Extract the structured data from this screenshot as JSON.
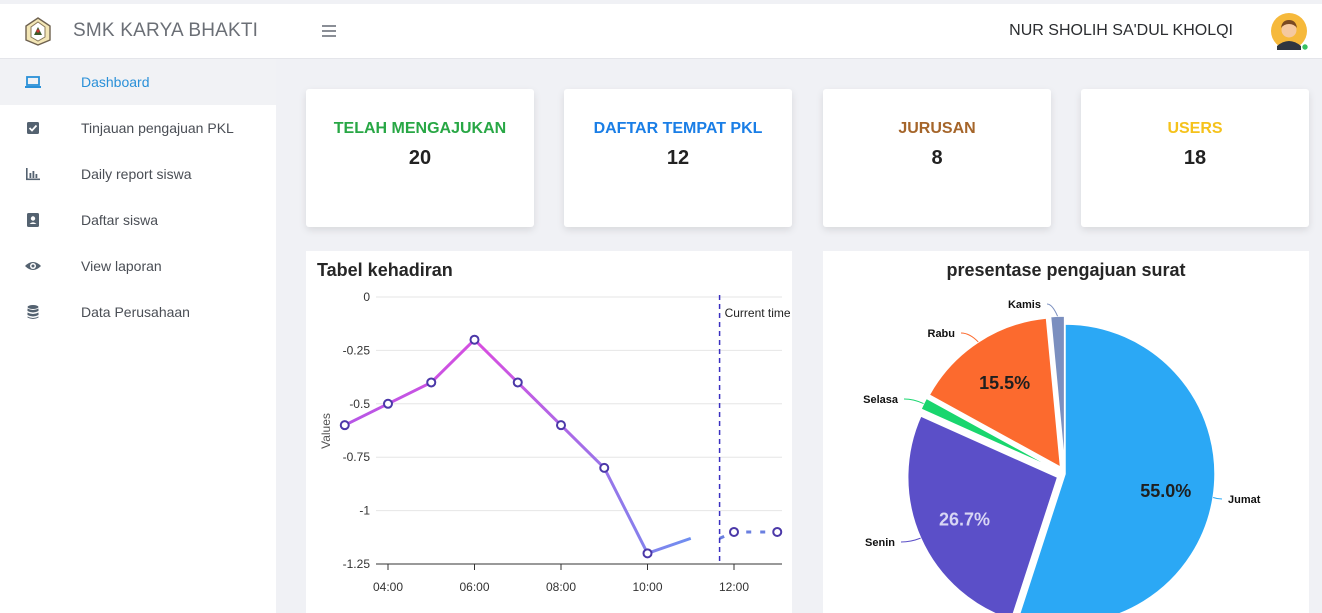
{
  "header": {
    "brand": "SMK KARYA BHAKTI",
    "user_name": "NUR SHOLIH SA'DUL KHOLQI"
  },
  "sidebar": {
    "items": [
      {
        "label": "Dashboard",
        "icon": "laptop-icon",
        "active": true
      },
      {
        "label": "Tinjauan pengajuan PKL",
        "icon": "check-square-icon"
      },
      {
        "label": "Daily report siswa",
        "icon": "bar-chart-icon"
      },
      {
        "label": "Daftar siswa",
        "icon": "address-book-icon"
      },
      {
        "label": "View laporan",
        "icon": "eye-icon"
      },
      {
        "label": "Data Perusahaan",
        "icon": "database-icon"
      }
    ]
  },
  "stats": [
    {
      "title": "TELAH MENGAJUKAN",
      "value": "20",
      "color": "#28a745"
    },
    {
      "title": "DAFTAR TEMPAT PKL",
      "value": "12",
      "color": "#1a7ee6"
    },
    {
      "title": "JURUSAN",
      "value": "8",
      "color": "#a5652a"
    },
    {
      "title": "USERS",
      "value": "18",
      "color": "#f5c21b"
    }
  ],
  "charts": {
    "attendance_title": "Tabel kehadiran",
    "pie_title": "presentase pengajuan surat"
  },
  "chart_data": [
    {
      "type": "line",
      "title": "Tabel kehadiran",
      "ylabel": "Values",
      "xlabel": "",
      "x": [
        "03:00",
        "04:00",
        "05:00",
        "06:00",
        "07:00",
        "08:00",
        "09:00",
        "10:00",
        "11:00",
        "11:40"
      ],
      "values": [
        -0.6,
        -0.5,
        -0.4,
        -0.2,
        -0.4,
        -0.6,
        -0.8,
        -1.2,
        -1.13
      ],
      "forecast_x": [
        "12:00",
        "13:00"
      ],
      "forecast_values": [
        -1.1,
        -1.1
      ],
      "ylim": [
        -1.25,
        0
      ],
      "y_ticks": [
        "0",
        "-0.25",
        "-0.5",
        "-0.75",
        "-1",
        "-1.25"
      ],
      "x_ticks": [
        "04:00",
        "06:00",
        "08:00",
        "10:00",
        "12:00"
      ],
      "annotation": "Current time",
      "annotation_x": "11:40",
      "grid": true
    },
    {
      "type": "pie",
      "title": "presentase pengajuan surat",
      "slices": [
        {
          "label": "Jumat",
          "value": 55.0,
          "display": "55.0%",
          "color": "#2ba8f5"
        },
        {
          "label": "Senin",
          "value": 26.7,
          "display": "26.7%",
          "color": "#5b4fc8"
        },
        {
          "label": "Selasa",
          "value": 1.3,
          "display": "",
          "color": "#19d66e"
        },
        {
          "label": "Rabu",
          "value": 15.5,
          "display": "15.5%",
          "color": "#fc6a2e"
        },
        {
          "label": "Kamis",
          "value": 1.5,
          "display": "",
          "color": "#7b8fbf"
        }
      ]
    }
  ]
}
